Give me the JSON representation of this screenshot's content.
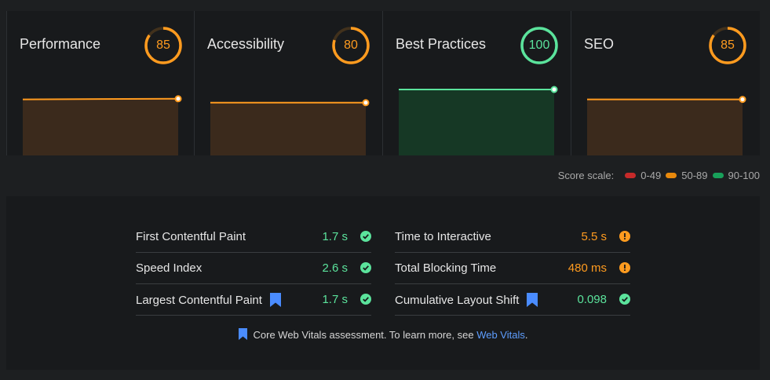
{
  "categories": [
    {
      "title": "Performance",
      "score": 85,
      "fraction": 0.85,
      "color": "#ff9b1f",
      "fill": "#3b2a1c",
      "trend": [
        85,
        86
      ]
    },
    {
      "title": "Accessibility",
      "score": 80,
      "fraction": 0.8,
      "color": "#ff9b1f",
      "fill": "#3b2a1c",
      "trend": [
        80,
        80
      ]
    },
    {
      "title": "Best Practices",
      "score": 100,
      "fraction": 1.0,
      "color": "#5be39c",
      "fill": "#163825",
      "trend": [
        100,
        100
      ]
    },
    {
      "title": "SEO",
      "score": 85,
      "fraction": 0.85,
      "color": "#ff9b1f",
      "fill": "#3b2a1c",
      "trend": [
        85,
        85
      ]
    }
  ],
  "legend": {
    "label": "Score scale:",
    "items": [
      {
        "label": "0-49",
        "color": "#c62a2a"
      },
      {
        "label": "50-89",
        "color": "#e8890c"
      },
      {
        "label": "90-100",
        "color": "#18a05a"
      }
    ]
  },
  "metrics": {
    "left": [
      {
        "label": "First Contentful Paint",
        "value": "1.7 s",
        "status": "pass",
        "cwv": false
      },
      {
        "label": "Speed Index",
        "value": "2.6 s",
        "status": "pass",
        "cwv": false
      },
      {
        "label": "Largest Contentful Paint",
        "value": "1.7 s",
        "status": "pass",
        "cwv": true
      }
    ],
    "right": [
      {
        "label": "Time to Interactive",
        "value": "5.5 s",
        "status": "average",
        "cwv": false
      },
      {
        "label": "Total Blocking Time",
        "value": "480 ms",
        "status": "average",
        "cwv": false
      },
      {
        "label": "Cumulative Layout Shift",
        "value": "0.098",
        "status": "pass",
        "cwv": true
      }
    ]
  },
  "status_colors": {
    "pass": "#5be39c",
    "average": "#ff9b1f"
  },
  "note": {
    "text": "Core Web Vitals assessment. To learn more, see ",
    "link": "Web Vitals",
    "suffix": "."
  },
  "bookmark_color": "#4a8cff"
}
